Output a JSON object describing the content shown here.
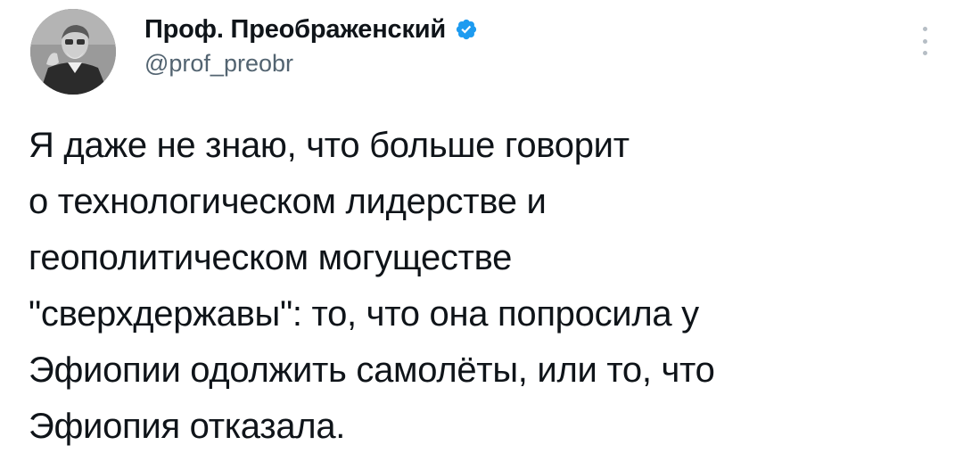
{
  "author": {
    "display_name": "Проф. Преображенский",
    "handle": "@prof_preobr",
    "verified": true
  },
  "icons": {
    "verified": "verified-badge-icon",
    "more": "more-vertical-icon"
  },
  "colors": {
    "text": "#0f1419",
    "secondary_text": "#536471",
    "verified_blue": "#1d9bf0"
  },
  "tweet": {
    "text": "Я даже не знаю, что больше говорит\nо технологическом лидерстве и\nгеополитическом могуществе\n\"сверхдержавы\": то, что она попросила у\nЭфиопии одолжить самолёты, или то, что\nЭфиопия отказала."
  }
}
